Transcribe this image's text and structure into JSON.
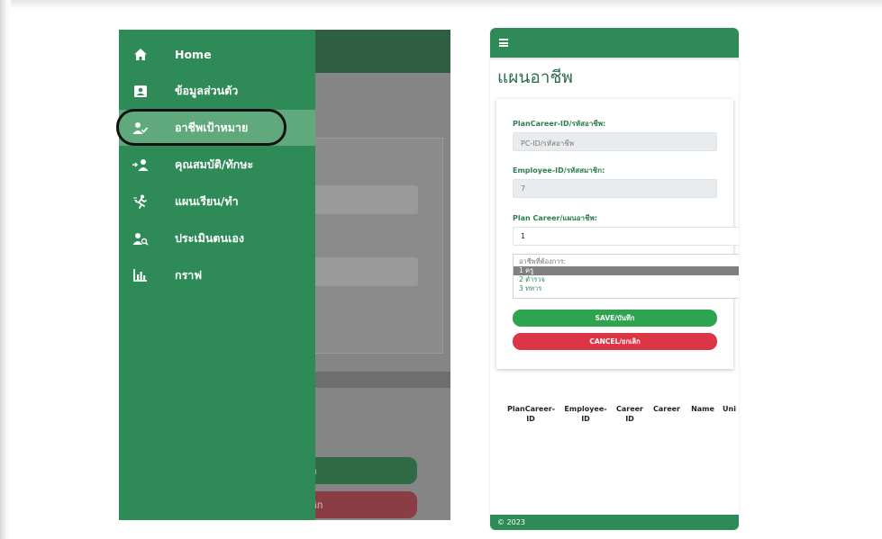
{
  "left_screen": {
    "drawer": {
      "items": [
        {
          "label": "Home",
          "icon": "home-icon",
          "active": false
        },
        {
          "label": "ข้อมูลส่วนตัว",
          "icon": "id-card-icon",
          "active": false
        },
        {
          "label": "อาชีพเป้าหมาย",
          "icon": "user-check-icon",
          "active": true
        },
        {
          "label": "คุณสมบัติ/ทักษะ",
          "icon": "user-skills-icon",
          "active": false
        },
        {
          "label": "แผนเรียน/ทำ",
          "icon": "running-person-icon",
          "active": false
        },
        {
          "label": "ประเมินตนเอง",
          "icon": "user-search-icon",
          "active": false
        },
        {
          "label": "กราฟ",
          "icon": "bar-chart-icon",
          "active": false
        }
      ]
    },
    "background_buttons": {
      "save_fragment": "อ",
      "cancel_fragment": "ลิก"
    }
  },
  "right_screen": {
    "page_title": "แผนอาชีพ",
    "form": {
      "plan_career_id": {
        "label": "PlanCareer-ID/รหัสอาชีพ:",
        "placeholder": "PC-ID/รหัสอาชีพ"
      },
      "employee_id": {
        "label": "Employee-ID/รหัสสมาชิก:",
        "value": "7"
      },
      "plan_career": {
        "label": "Plan Career/แผนอาชีพ:",
        "value": "1"
      },
      "career_list": {
        "placeholder": "อาชีพที่ต้องการ:",
        "options": [
          "1 ครู",
          "2 ตำรวจ",
          "3 ทหาร"
        ],
        "selected_index": 0
      },
      "save_label": "SAVE/บันทึก",
      "cancel_label": "CANCEL/ยกเลิก"
    },
    "table": {
      "columns": [
        "PlanCareer-ID",
        "Employee-ID",
        "Career ID",
        "Career",
        "Name",
        "Uni"
      ]
    },
    "footer": "© 2023"
  },
  "colors": {
    "drawer_green": "#2e8a56",
    "active_item": "#5fa97d",
    "save_green": "#2ea44f",
    "cancel_red": "#dc3545"
  }
}
